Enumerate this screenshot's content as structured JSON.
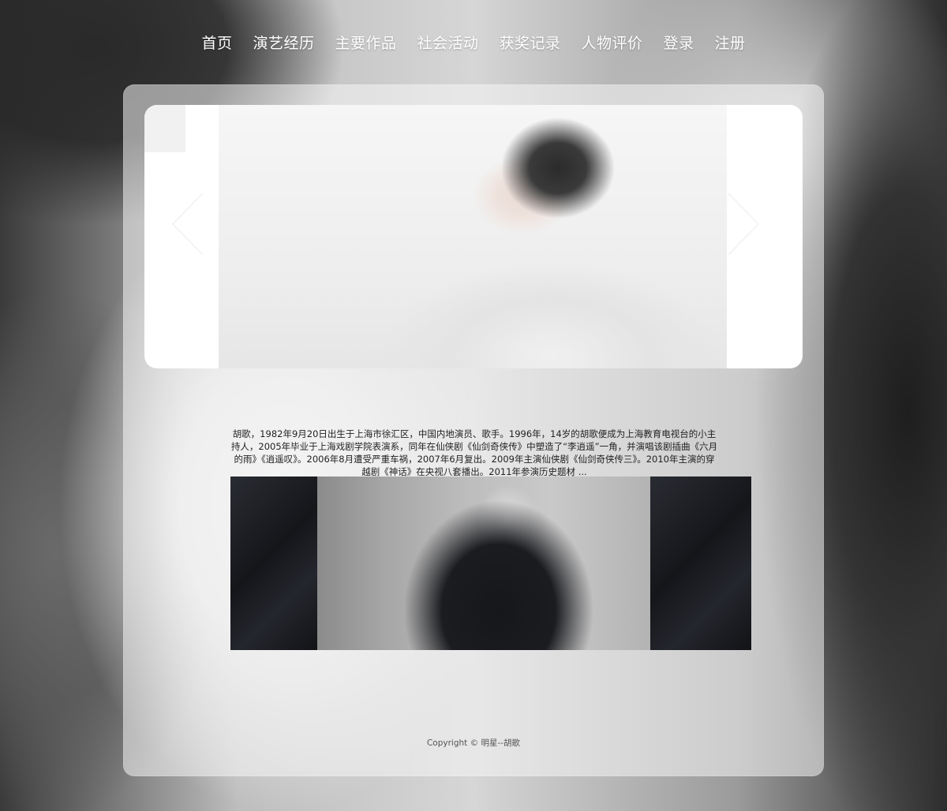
{
  "nav": {
    "items": [
      {
        "label": "首页"
      },
      {
        "label": "演艺经历"
      },
      {
        "label": "主要作品"
      },
      {
        "label": "社会活动"
      },
      {
        "label": "获奖记录"
      },
      {
        "label": "人物评价"
      },
      {
        "label": "登录"
      },
      {
        "label": "注册"
      }
    ]
  },
  "slider": {
    "prev_icon": "chevron-left-icon",
    "next_icon": "chevron-right-icon"
  },
  "intro": {
    "text": "胡歌，1982年9月20日出生于上海市徐汇区，中国内地演员、歌手。1996年，14岁的胡歌便成为上海教育电视台的小主持人，2005年毕业于上海戏剧学院表演系，同年在仙侠剧《仙剑奇侠传》中塑造了“李逍遥”一角，并演唱该剧插曲《六月的雨》《逍遥叹》。2006年8月遭受严重车祸，2007年6月复出。2009年主演仙侠剧《仙剑奇侠传三》。2010年主演的穿越剧《神话》在央视八套播出。2011年参演历史题材 ..."
  },
  "footer": {
    "copyright": "Copyright © 明星--胡歌"
  },
  "colors": {
    "nav_text": "#ffffff",
    "panel_bg": "rgba(245,245,245,0.55)",
    "body_text": "#222222"
  }
}
